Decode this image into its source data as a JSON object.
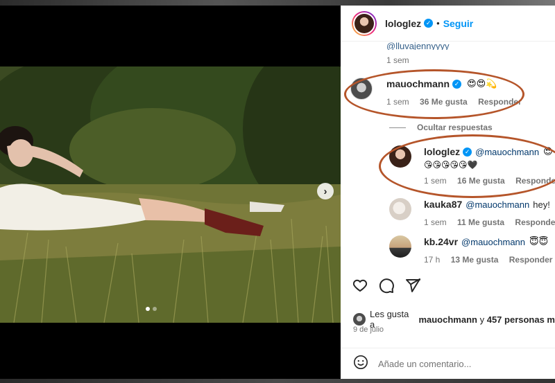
{
  "post": {
    "author": "lologlez",
    "follow_label": "Seguir",
    "separator": "•",
    "next_icon": "chevron-right-icon"
  },
  "comments": {
    "truncated_mention": "@lluvajennyyyy_",
    "truncated_time": "1 sem",
    "main": {
      "username": "mauochmann",
      "text": "😍😍💫",
      "time": "1 sem",
      "likes": "36 Me gusta",
      "reply": "Responder"
    },
    "hide_replies": "Ocultar respuestas",
    "replies": [
      {
        "username": "lologlez",
        "mention": "@mauochmann",
        "text": "😍",
        "line2": "😘😘😘😘😘🖤",
        "time": "1 sem",
        "likes": "16 Me gusta",
        "reply": "Responder"
      },
      {
        "username": "kauka87",
        "mention": "@mauochmann",
        "text": "hey!",
        "time": "1 sem",
        "likes": "11 Me gusta",
        "reply": "Responder"
      },
      {
        "username": "kb.24vr",
        "mention": "@mauochmann",
        "text": "😇😇",
        "time": "17 h",
        "likes": "13 Me gusta",
        "reply": "Responder"
      }
    ]
  },
  "actions": {
    "icons": [
      "heart-icon",
      "comment-icon",
      "share-icon"
    ]
  },
  "likes": {
    "prefix": "Les gusta a",
    "user": "mauochmann",
    "joiner": "y",
    "others": "457 personas m"
  },
  "date": "9 de julio",
  "composer": {
    "placeholder": "Añade un comentario..."
  },
  "colors": {
    "accent": "#0095f6",
    "annotation": "#b5552a"
  }
}
